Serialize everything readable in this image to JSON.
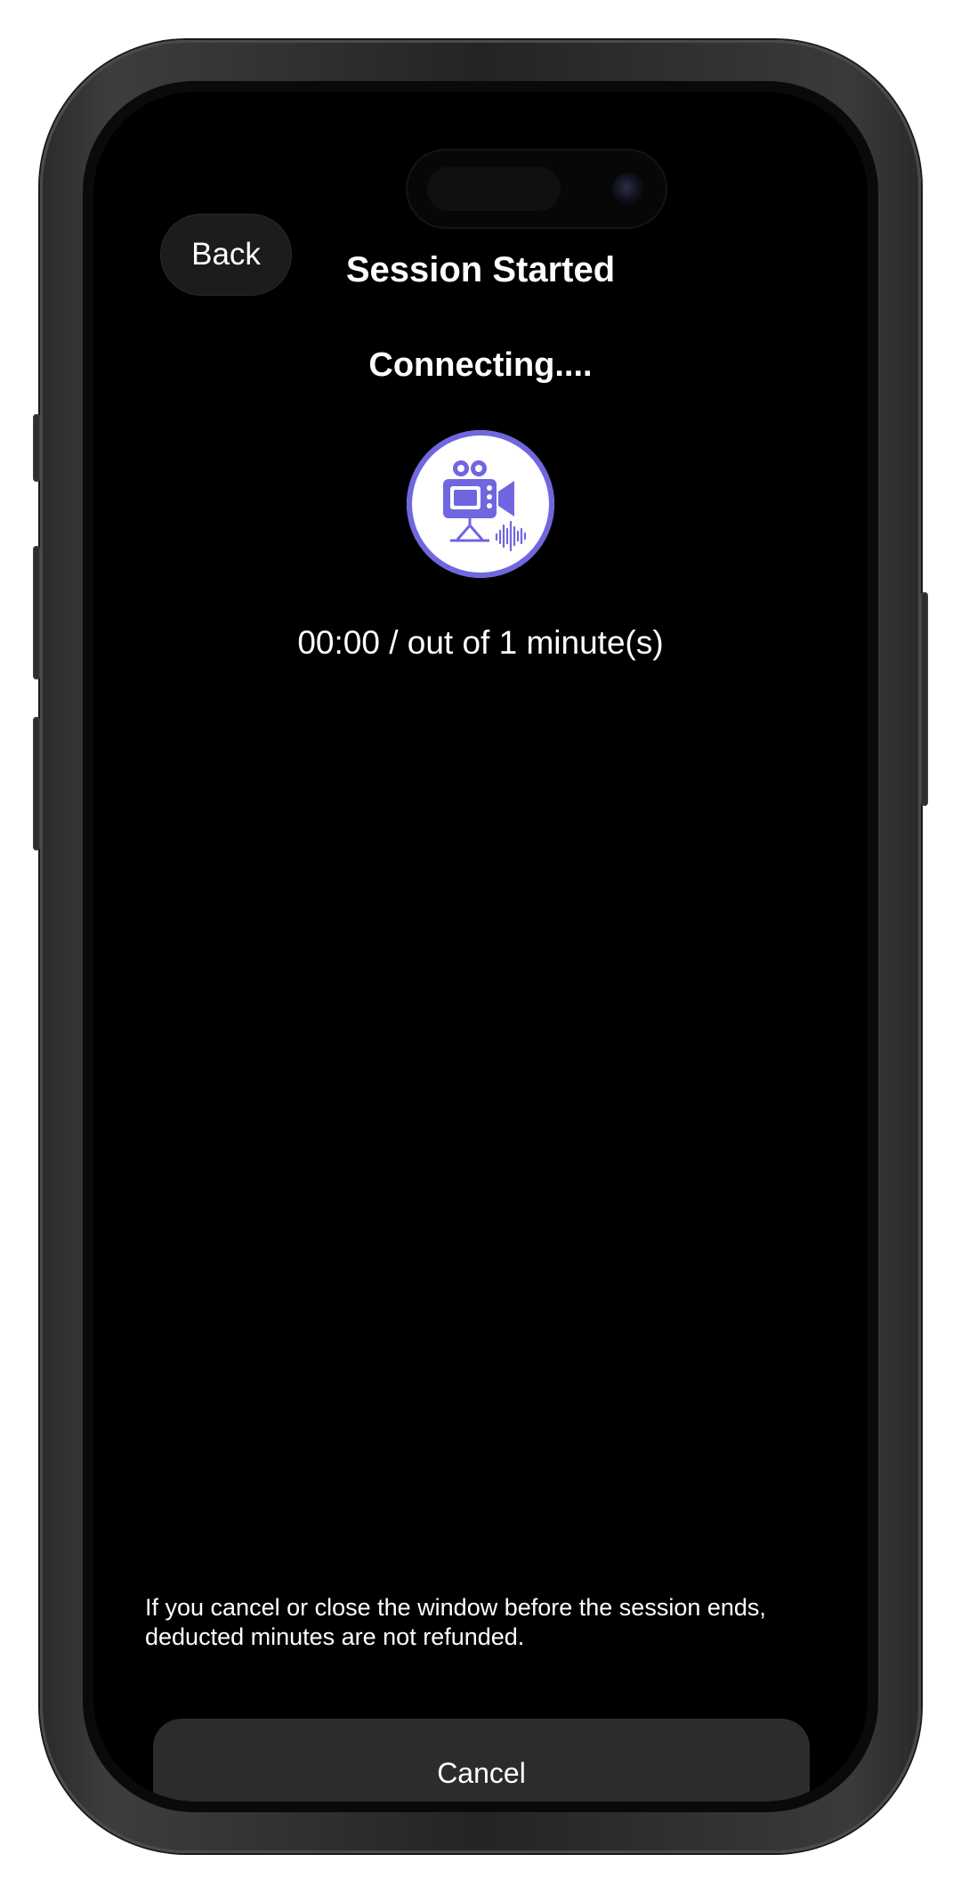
{
  "header": {
    "back_label": "Back",
    "title": "Session Started"
  },
  "session": {
    "status": "Connecting....",
    "avatar_icon": "video-camera-icon",
    "timer": "00:00 / out of 1 minute(s)"
  },
  "footer": {
    "disclaimer_line1": "If you cancel or close the window before the session ends,",
    "disclaimer_line2": "deducted minutes are not refunded.",
    "cancel_label": "Cancel"
  },
  "colors": {
    "background": "#000000",
    "accent": "#6f66e0",
    "button_bg": "#2c2c2e",
    "text": "#ffffff"
  }
}
